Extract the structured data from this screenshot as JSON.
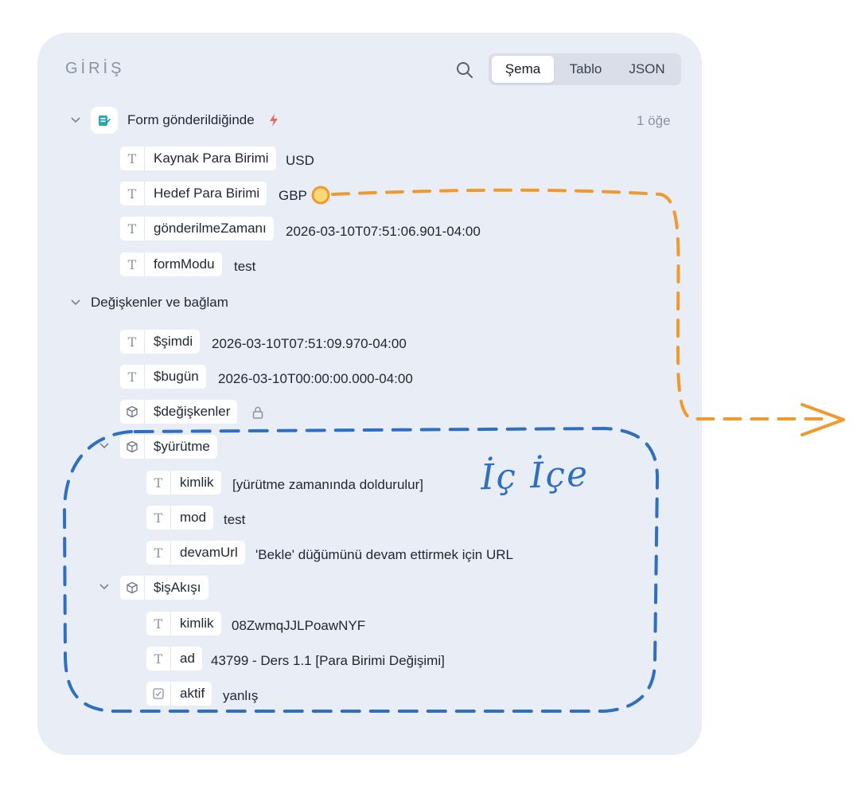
{
  "panel": {
    "title": "GİRİŞ",
    "tabs": [
      {
        "label": "Şema",
        "active": true
      },
      {
        "label": "Tablo",
        "active": false
      },
      {
        "label": "JSON",
        "active": false
      }
    ]
  },
  "trigger": {
    "label": "Form gönderildiğinde",
    "count": "1 öğe",
    "fields": [
      {
        "type_icon": "T",
        "name": "Kaynak Para Birimi",
        "value": "USD"
      },
      {
        "type_icon": "T",
        "name": "Hedef Para Birimi",
        "value": "GBP"
      },
      {
        "type_icon": "T",
        "name": "gönderilmeZamanı",
        "value": "2026-03-10T07:51:06.901-04:00"
      },
      {
        "type_icon": "T",
        "name": "formModu",
        "value": "test"
      }
    ]
  },
  "variables": {
    "label": "Değişkenler ve bağlam",
    "items": [
      {
        "type_icon": "T",
        "name": "$şimdi",
        "value": "2026-03-10T07:51:09.970-04:00"
      },
      {
        "type_icon": "T",
        "name": "$bugün",
        "value": "2026-03-10T00:00:00.000-04:00"
      },
      {
        "type_icon": "cube",
        "name": "$değişkenler",
        "value": ""
      }
    ],
    "execution": {
      "name": "$yürütme",
      "fields": [
        {
          "type_icon": "T",
          "name": "kimlik",
          "value": "[yürütme zamanında doldurulur]"
        },
        {
          "type_icon": "T",
          "name": "mod",
          "value": "test"
        },
        {
          "type_icon": "T",
          "name": "devamUrl",
          "value": "'Bekle' düğümünü devam ettirmek için URL"
        }
      ]
    },
    "workflow": {
      "name": "$işAkışı",
      "fields": [
        {
          "type_icon": "T",
          "name": "kimlik",
          "value": "08ZwmqJJLPoawNYF"
        },
        {
          "type_icon": "T",
          "name": "ad",
          "value": "43799 - Ders 1.1 [Para Birimi Değişimi]"
        },
        {
          "type_icon": "checkbox",
          "name": "aktif",
          "value": "yanlış"
        }
      ]
    }
  },
  "annotation": {
    "text": "İç İçe",
    "colors": {
      "orange": "#ef9a2e",
      "blue": "#2f6fc0"
    }
  },
  "colors": {
    "panel_bg": "#e9edf5",
    "chip_bg": "#ffffff",
    "muted": "#8a93a3",
    "bolt": "#f0625a"
  }
}
